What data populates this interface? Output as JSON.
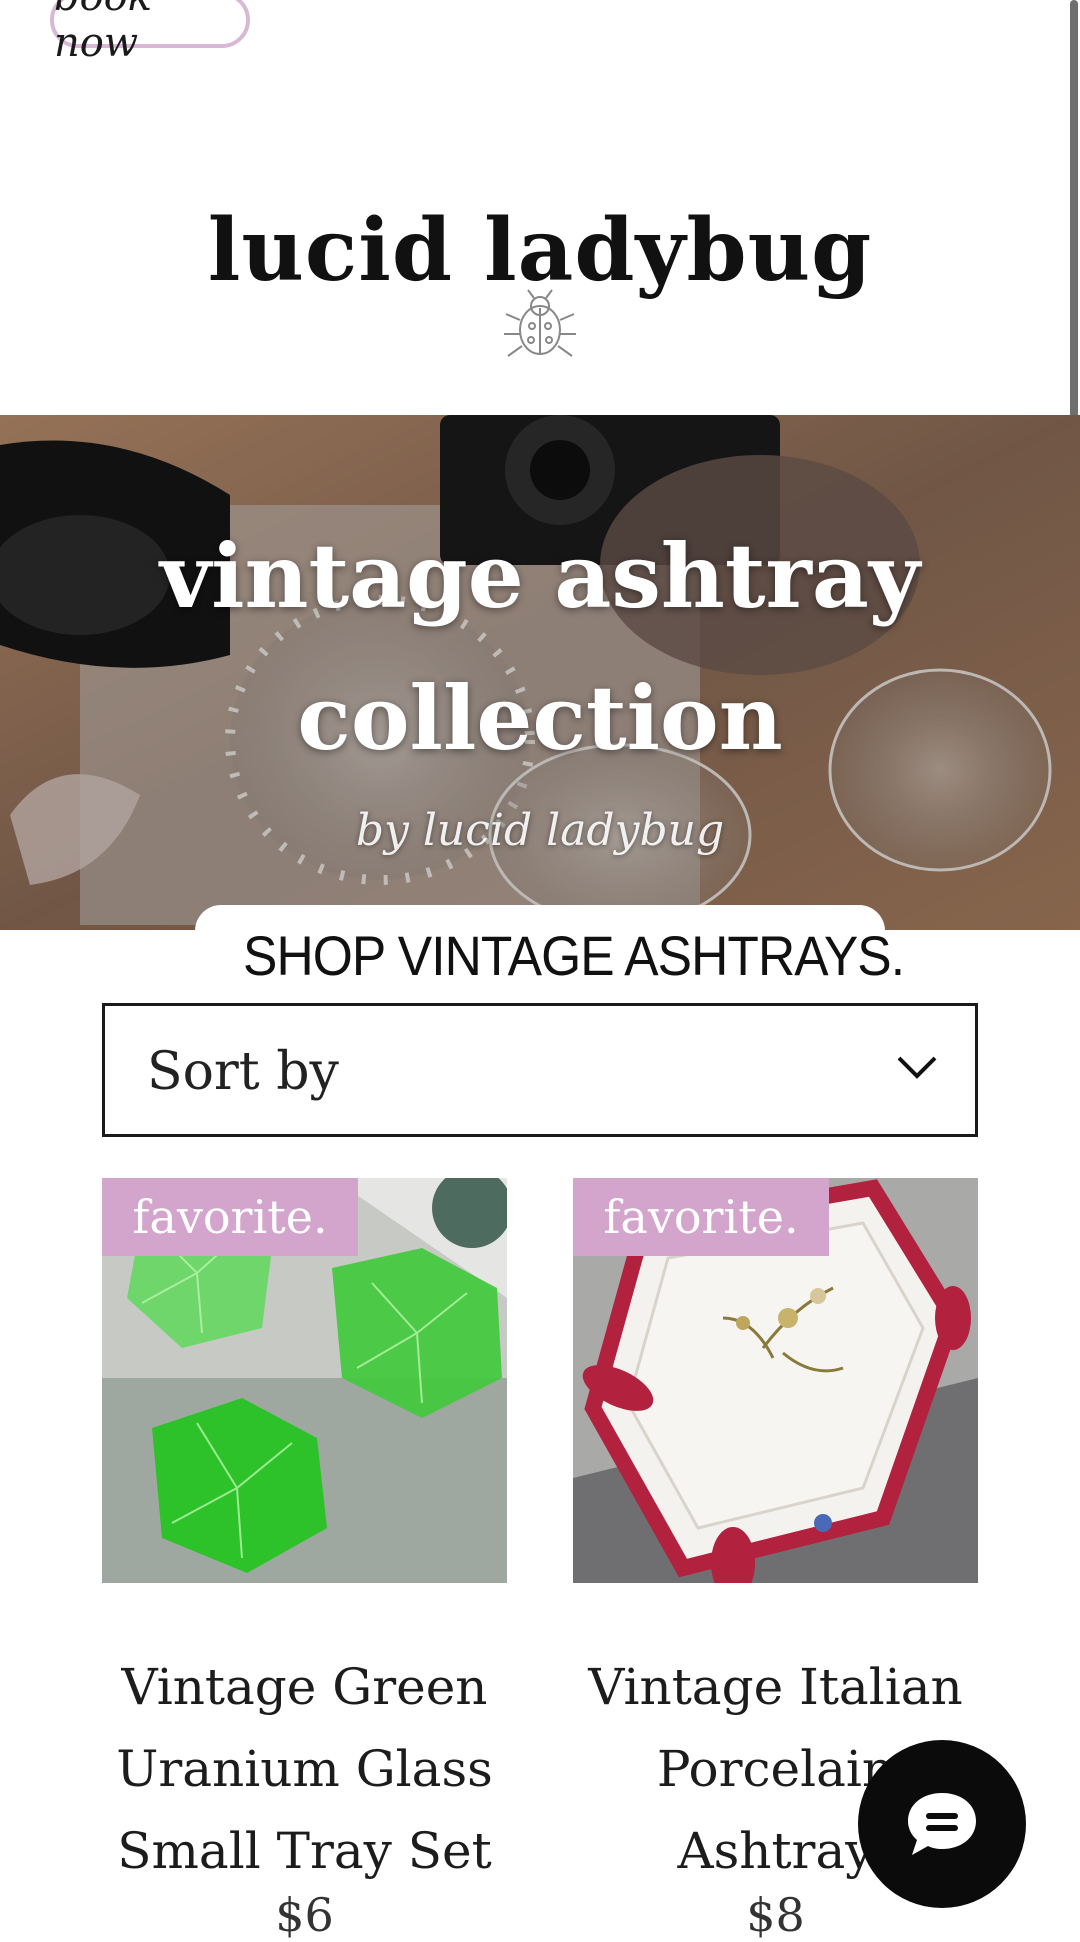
{
  "header": {
    "book_now_label": "book now",
    "brand": "lucid ladybug"
  },
  "hero": {
    "title_line1": "vintage ashtray",
    "title_line2": "collection",
    "subtitle": "by lucid ladybug"
  },
  "sticker": {
    "label": "SHOP VINTAGE ASHTRAYS.",
    "icon": "link-icon"
  },
  "sort": {
    "label": "Sort by",
    "icon": "chevron-down-icon"
  },
  "products": [
    {
      "badge": "favorite.",
      "title_lines": [
        "Vintage Green",
        "Uranium Glass",
        "Small Tray Set"
      ],
      "price": "$6"
    },
    {
      "badge": "favorite.",
      "title_lines": [
        "Vintage Italian",
        "Porcelain",
        "Ashtray"
      ],
      "price": "$8"
    }
  ],
  "chat": {
    "icon": "chat-icon"
  },
  "colors": {
    "badge": "#d3a4cc",
    "book_now_border": "#d9b8d6",
    "chat_bg": "#0b0b0b"
  }
}
